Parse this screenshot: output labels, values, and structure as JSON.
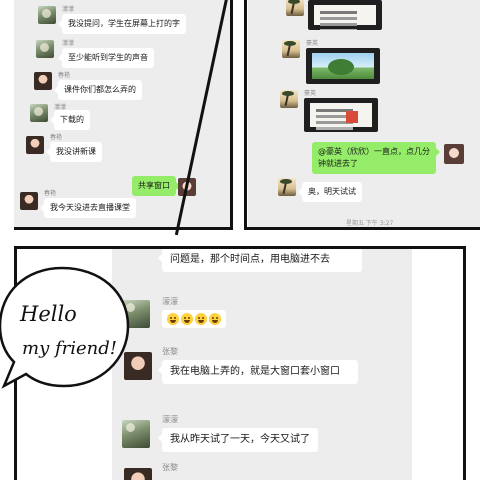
{
  "left_panel": {
    "messages": [
      {
        "name": "濛濛",
        "text": "我没提问，学生在屏幕上打的字"
      },
      {
        "name": "濛濛",
        "text": "至少能听到学生的声音"
      },
      {
        "name": "春艳",
        "text": "课件你们都怎么弄的"
      },
      {
        "name": "濛濛",
        "text": "下载的"
      },
      {
        "name": "春艳",
        "text": "我没讲新课"
      },
      {
        "name": "",
        "text": "共享窗口"
      },
      {
        "name": "春艳",
        "text": "我今天没进去直播课堂"
      }
    ]
  },
  "right_panel": {
    "names": [
      "豪英",
      "豪英",
      "豪英"
    ],
    "mention_message": "@豪英（欣欣）一直点，点几分钟就进去了",
    "reply_message": "奥，明天试试",
    "timestamp": "星期五 下午 3:27"
  },
  "bottom_panel": {
    "messages": [
      {
        "name": "",
        "text": "问题是，那个时间点，用电脑进不去"
      },
      {
        "name": "濛濛",
        "text": ""
      },
      {
        "name": "张黎",
        "text": "我在电脑上弄的，就是大窗口套小窗口"
      },
      {
        "name": "濛濛",
        "text": "我从昨天试了一天，今天又试了"
      },
      {
        "name": "张黎",
        "text": ""
      }
    ]
  },
  "speech_bubble": {
    "line1": "Hello",
    "line2": "my friend!"
  }
}
